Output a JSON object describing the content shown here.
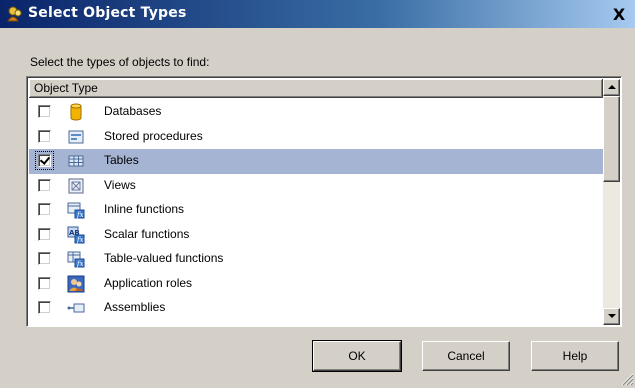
{
  "window": {
    "title": "Select Object Types",
    "close_symbol": "X"
  },
  "prompt": "Select the types of objects to find:",
  "list": {
    "column_header": "Object Type",
    "items": [
      {
        "label": "Databases",
        "checked": false,
        "icon": "database-icon"
      },
      {
        "label": "Stored procedures",
        "checked": false,
        "icon": "stored-procedure-icon"
      },
      {
        "label": "Tables",
        "checked": true,
        "selected": true,
        "icon": "table-icon"
      },
      {
        "label": "Views",
        "checked": false,
        "icon": "view-icon"
      },
      {
        "label": "Inline functions",
        "checked": false,
        "icon": "inline-function-icon"
      },
      {
        "label": "Scalar functions",
        "checked": false,
        "icon": "scalar-function-icon"
      },
      {
        "label": "Table-valued functions",
        "checked": false,
        "icon": "table-valued-function-icon"
      },
      {
        "label": "Application roles",
        "checked": false,
        "icon": "application-role-icon"
      },
      {
        "label": "Assemblies",
        "checked": false,
        "icon": "assembly-icon"
      },
      {
        "label": "",
        "checked": false,
        "icon": "asymmetric-key-icon"
      }
    ]
  },
  "buttons": {
    "ok": "OK",
    "cancel": "Cancel",
    "help": "Help"
  },
  "colors": {
    "selection": "#a6b4d4",
    "titlebar_start": "#0a246a",
    "titlebar_end": "#a6caf0",
    "dialog_face": "#d4d0c8"
  }
}
